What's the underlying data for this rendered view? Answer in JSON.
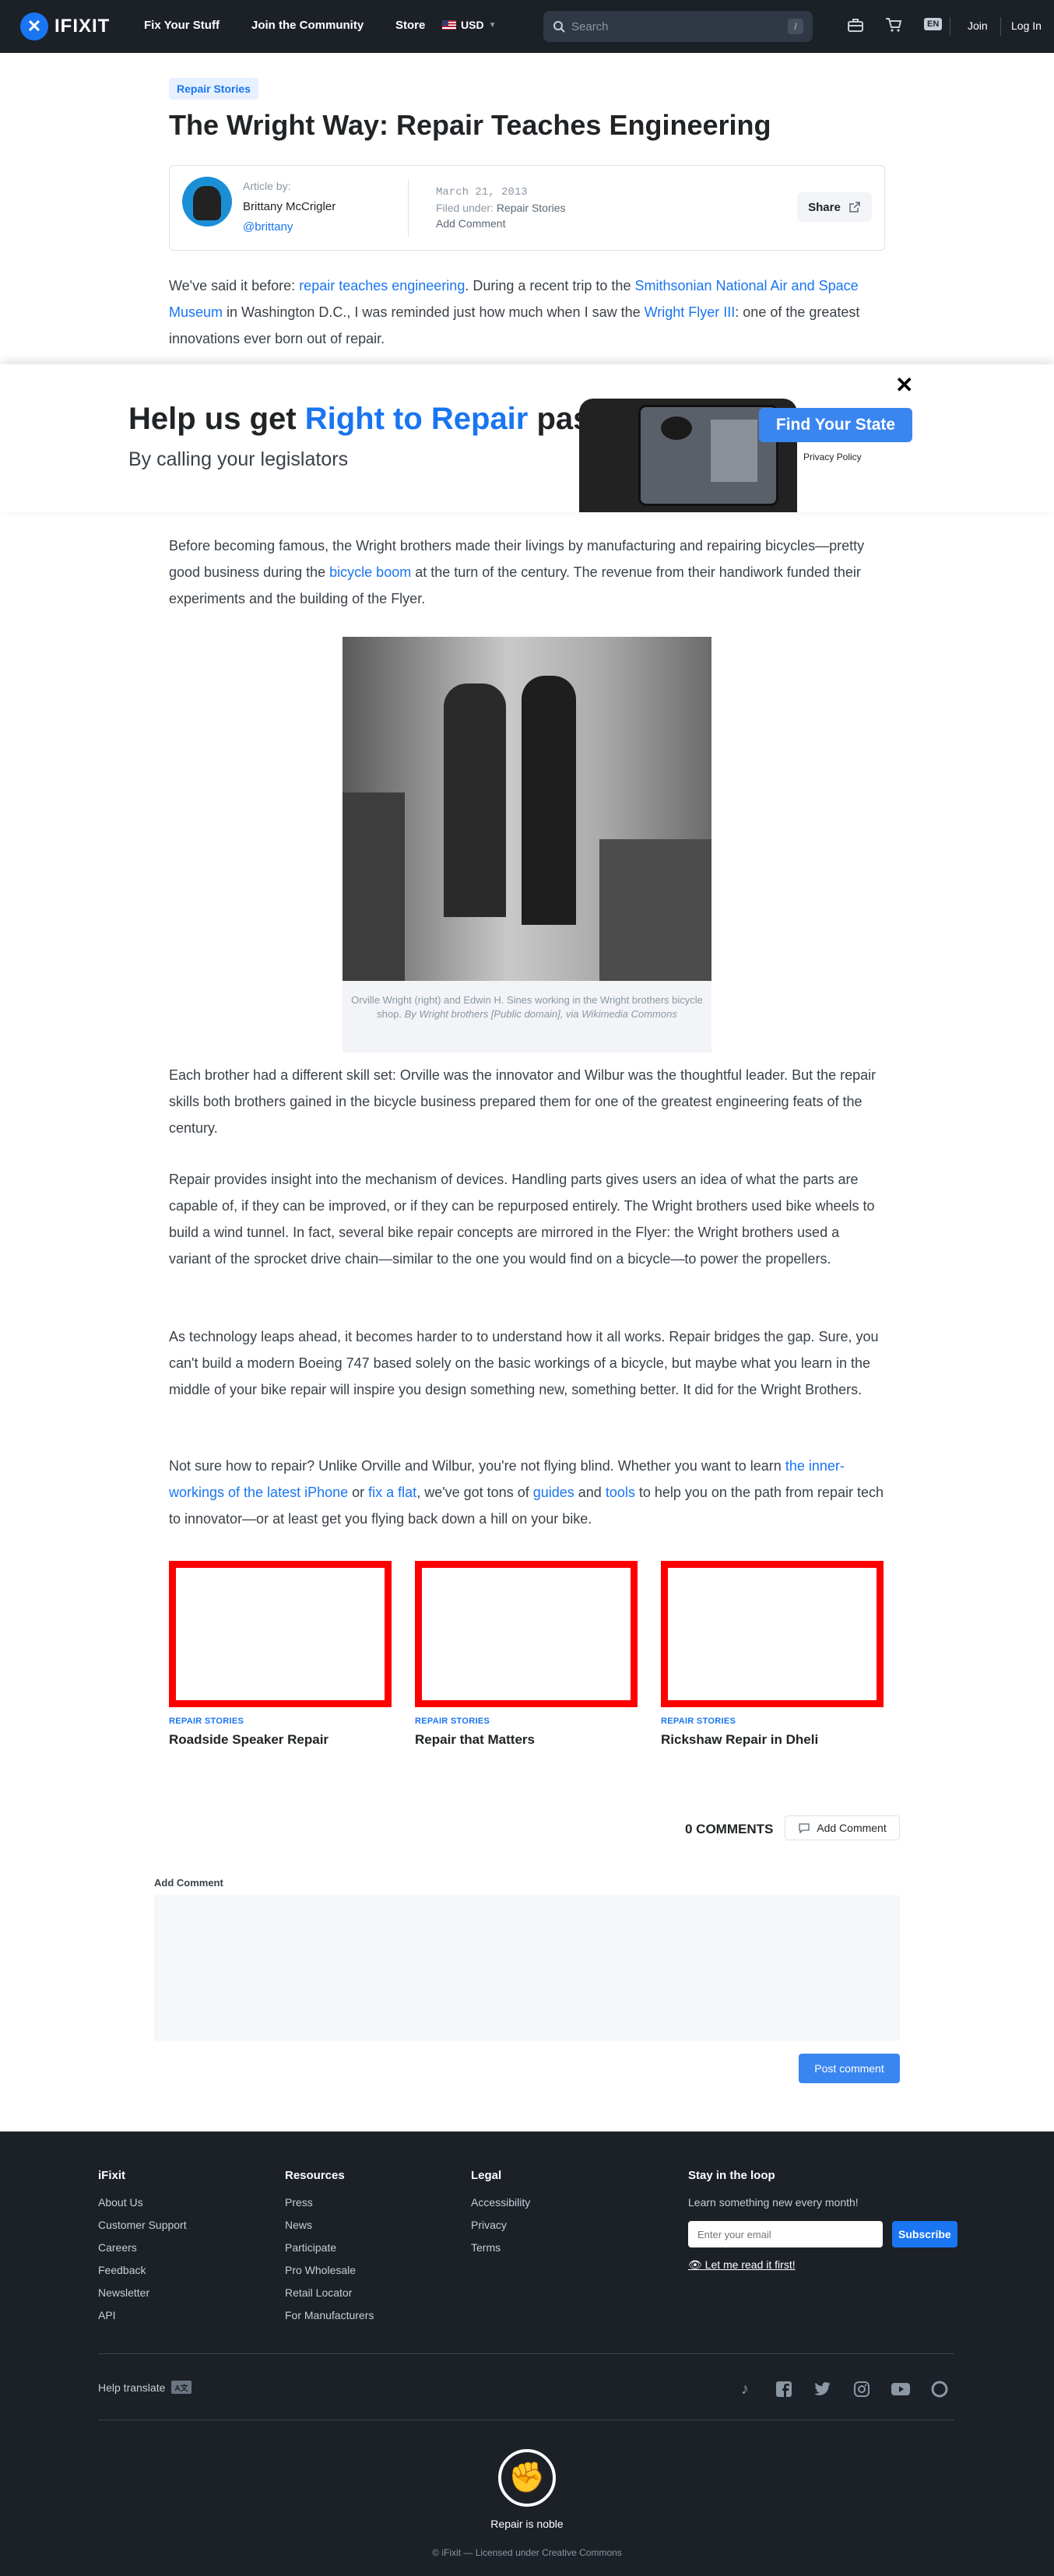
{
  "nav": {
    "logo_text": "IFIXIT",
    "links": [
      "Fix Your Stuff",
      "Join the Community",
      "Store"
    ],
    "currency": "USD",
    "search_placeholder": "Search",
    "search_shortcut": "/",
    "language": "EN",
    "join": "Join",
    "login": "Log In"
  },
  "article": {
    "tag": "Repair Stories",
    "title": "The Wright Way: Repair Teaches Engineering",
    "article_by_label": "Article by:",
    "author": "Brittany McCrigler",
    "handle": "@brittany",
    "date": "March 21, 2013",
    "filed_label": "Filed under:",
    "filed_value": "Repair Stories",
    "add_comment": "Add Comment",
    "share": "Share"
  },
  "intro": {
    "t1": "We've said it before: ",
    "l1": "repair teaches engineering",
    "t2": ". During a recent trip to the ",
    "l2": "Smithsonian National Air and Space Museum",
    "t3": " in Washington D.C., I was reminded just how much when I saw the ",
    "l3": "Wright Flyer III",
    "t4": ": one of the greatest innovations ever born out of repair."
  },
  "banner": {
    "title_pre": "Help us get ",
    "title_hl": "Right to Repair",
    "title_post": " passed",
    "subtitle": "By calling your legislators",
    "button": "Find Your State",
    "privacy": "Privacy Policy"
  },
  "p1": {
    "t1": "Before becoming famous, the Wright brothers made their livings by manufacturing and repairing bicycles—pretty good business during the ",
    "l1": "bicycle boom",
    "t2": " at the turn of the century. The revenue from their handiwork funded their experiments and the building of the Flyer."
  },
  "figure": {
    "caption": "Orville Wright (right) and Edwin H. Sines working in the Wright brothers bicycle shop. ",
    "credit": "By Wright brothers [Public domain], via Wikimedia Commons"
  },
  "p2": "Each brother had a different skill set: Orville was the innovator and Wilbur was the thoughtful leader. But the repair skills both brothers gained in the bicycle business prepared them for one of the greatest engineering feats of the century.",
  "p3": "Repair provides insight into the mechanism of devices. Handling parts gives users an idea of what the parts are capable of, if they can be improved, or if they can be repurposed entirely. The Wright brothers used bike wheels to build a wind tunnel. In fact, several bike repair concepts are mirrored in the Flyer: the Wright brothers used a variant of the sprocket drive chain—similar to the one you would find on a bicycle—to power the propellers.",
  "p4": "As technology leaps ahead, it becomes harder to to understand how it all works. Repair bridges the gap. Sure, you can't build a modern Boeing 747 based solely on the basic workings of a bicycle, but maybe what you learn in the middle of your bike repair will inspire you design something new, something better. It did for the Wright Brothers.",
  "p5": {
    "t1": "Not sure how to repair? Unlike Orville and Wilbur, you're not flying blind. Whether you want to learn ",
    "l1": "the inner-workings of the latest iPhone",
    "t2": " or ",
    "l2": "fix a flat",
    "t3": ", we've got tons of ",
    "l3": "guides",
    "t4": " and ",
    "l4": "tools",
    "t5": " to help you on the path from repair tech to innovator—or at least get you flying back down a hill on your bike."
  },
  "related": [
    {
      "category": "REPAIR STORIES",
      "title": "Roadside Speaker Repair"
    },
    {
      "category": "REPAIR STORIES",
      "title": "Repair that Matters"
    },
    {
      "category": "REPAIR STORIES",
      "title": "Rickshaw Repair in Dheli"
    }
  ],
  "comments": {
    "count": "0 COMMENTS",
    "add_button": "Add Comment",
    "form_label": "Add Comment",
    "post_button": "Post comment"
  },
  "footer": {
    "col1": {
      "title": "iFixit",
      "items": [
        "About Us",
        "Customer Support",
        "Careers",
        "Feedback",
        "Newsletter",
        "API"
      ]
    },
    "col2": {
      "title": "Resources",
      "items": [
        "Press",
        "News",
        "Participate",
        "Pro Wholesale",
        "Retail Locator",
        "For Manufacturers"
      ]
    },
    "col3": {
      "title": "Legal",
      "items": [
        "Accessibility",
        "Privacy",
        "Terms"
      ]
    },
    "loop": {
      "title": "Stay in the loop",
      "desc": "Learn something new every month!",
      "email_placeholder": "Enter your email",
      "subscribe": "Subscribe",
      "read_first": "Let me read it first!"
    },
    "help_translate": "Help translate",
    "tagline": "Repair is noble",
    "license": "© iFixit — Licensed under Creative Commons"
  }
}
